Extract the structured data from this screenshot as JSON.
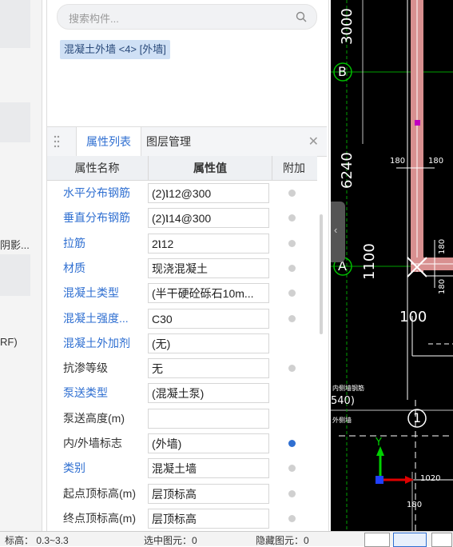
{
  "left_strip": {
    "label_1": "阴影...",
    "label_2": "RF)"
  },
  "search": {
    "placeholder": "搜索构件..."
  },
  "selected_component": "混凝土外墙 <4> [外墙]",
  "tabs": [
    {
      "label": "属性列表",
      "active": true
    },
    {
      "label": "图层管理",
      "active": false
    }
  ],
  "table": {
    "headers": [
      "属性名称",
      "属性值",
      "附加"
    ],
    "rows": [
      {
        "name": "水平分布钢筋",
        "value": "(2)Ⲓ12@300",
        "blue": true,
        "checked": false
      },
      {
        "name": "垂直分布钢筋",
        "value": "(2)Ⲓ14@300",
        "blue": true,
        "checked": false
      },
      {
        "name": "拉筋",
        "value": "2Ⲓ12",
        "blue": true,
        "checked": false
      },
      {
        "name": "材质",
        "value": "现浇混凝土",
        "blue": true,
        "checked": false
      },
      {
        "name": "混凝土类型",
        "value": "(半干硬砼砾石10m...",
        "blue": true,
        "checked": false
      },
      {
        "name": "混凝土强度...",
        "value": "C30",
        "blue": true,
        "checked": false
      },
      {
        "name": "混凝土外加剂",
        "value": "(无)",
        "blue": true,
        "checked": null
      },
      {
        "name": "抗渗等级",
        "value": "无",
        "blue": false,
        "checked": false
      },
      {
        "name": "泵送类型",
        "value": "(混凝土泵)",
        "blue": true,
        "checked": null
      },
      {
        "name": "泵送高度(m)",
        "value": "",
        "blue": false,
        "checked": null
      },
      {
        "name": "内/外墙标志",
        "value": "(外墙)",
        "blue": false,
        "checked": true
      },
      {
        "name": "类别",
        "value": "混凝土墙",
        "blue": true,
        "checked": false
      },
      {
        "name": "起点顶标高(m)",
        "value": "层顶标高",
        "blue": false,
        "checked": false
      },
      {
        "name": "终点顶标高(m)",
        "value": "层顶标高",
        "blue": false,
        "checked": false
      }
    ]
  },
  "cad": {
    "dim_3000": "3000",
    "dim_6240": "6240",
    "axis_b": "B",
    "axis_a": "A",
    "axis_1": "1",
    "num_180_a": "180",
    "num_180_b": "180",
    "num_180_c": "180",
    "num_180_d": "180",
    "num_180_e": "180",
    "label_1100": "1100",
    "label_100": "100",
    "note_1": "内侧墙钢筋",
    "note_2": "540)",
    "note_3": "外侧墙",
    "num_1020": "1020",
    "axis_y": "Y",
    "colors": {
      "axis_green": "#00c000",
      "wall_pink": "#e8a0a0",
      "wall_red": "#c03030"
    }
  },
  "status_bar": {
    "item_1": "标高：  0.3~3.3",
    "item_2": "选中图元：0",
    "item_3": "隐藏图元：0"
  }
}
